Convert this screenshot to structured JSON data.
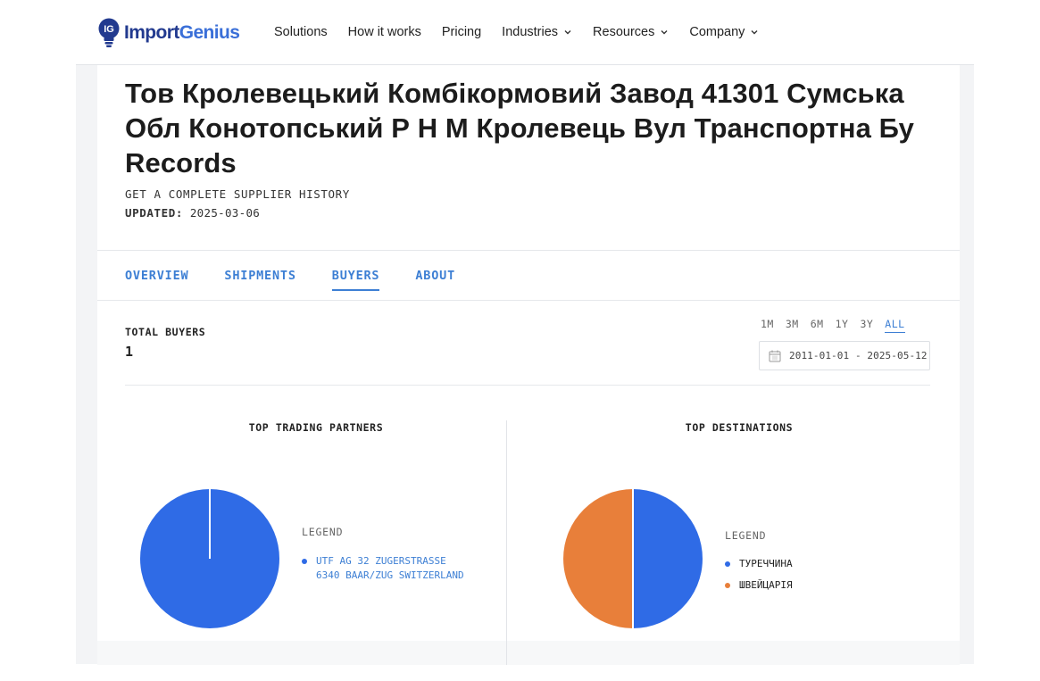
{
  "header": {
    "brand": {
      "part1": "Import",
      "part2": "Genius",
      "mark_text": "IG"
    },
    "nav": [
      {
        "label": "Solutions",
        "dropdown": false
      },
      {
        "label": "How it works",
        "dropdown": false
      },
      {
        "label": "Pricing",
        "dropdown": false
      },
      {
        "label": "Industries",
        "dropdown": true
      },
      {
        "label": "Resources",
        "dropdown": true
      },
      {
        "label": "Company",
        "dropdown": true
      }
    ]
  },
  "page": {
    "title": "Тов Кролевецький Комбікормовий Завод 41301 Сумська Обл Конотопський Р Н М Кролевець Вул Транспортна Бу Records",
    "subhead": "GET A COMPLETE SUPPLIER HISTORY",
    "updated_label": "UPDATED:",
    "updated_value": "2025-03-06"
  },
  "tabs": [
    {
      "label": "OVERVIEW",
      "active": false
    },
    {
      "label": "SHIPMENTS",
      "active": false
    },
    {
      "label": "BUYERS",
      "active": true
    },
    {
      "label": "ABOUT",
      "active": false
    }
  ],
  "stats": {
    "total_buyers_label": "TOTAL BUYERS",
    "total_buyers_value": "1"
  },
  "date_filter": {
    "ranges": [
      "1M",
      "3M",
      "6M",
      "1Y",
      "3Y",
      "ALL"
    ],
    "active_range": "ALL",
    "date_range": "2011-01-01 - 2025-05-12"
  },
  "colors": {
    "accent": "#3d7fd4",
    "series_blue": "#2f6be6",
    "series_orange": "#e87f3a",
    "brand_dark": "#223a8f"
  },
  "chart_data": [
    {
      "type": "pie",
      "title": "TOP TRADING PARTNERS",
      "legend_title": "LEGEND",
      "slices": [
        {
          "label": "UTF AG 32 ZUGERSTRASSE 6340 BAAR/ZUG SWITZERLAND",
          "value": 100,
          "color": "#2f6be6"
        }
      ]
    },
    {
      "type": "pie",
      "title": "TOP DESTINATIONS",
      "legend_title": "LEGEND",
      "slices": [
        {
          "label": "ТУРЕЧЧИНА",
          "value": 50,
          "color": "#2f6be6"
        },
        {
          "label": "ШВЕЙЦАРІЯ",
          "value": 50,
          "color": "#e87f3a"
        }
      ]
    }
  ]
}
